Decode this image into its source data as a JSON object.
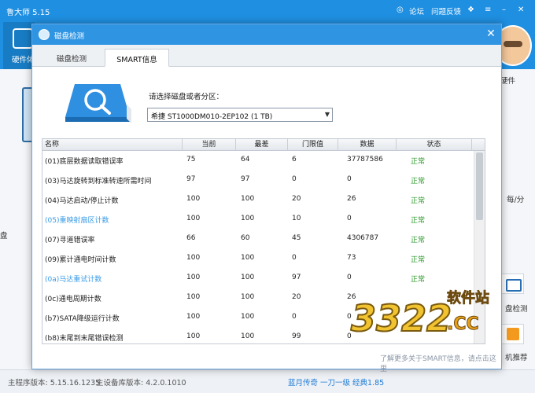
{
  "window": {
    "title": "鲁大师 5.15",
    "links": {
      "forum": "论坛",
      "feedback": "问题反馈"
    }
  },
  "toolbar": {
    "hardware_label": "硬件体"
  },
  "right_panel": {
    "hardware_label": "硬件",
    "rate_label": "每/分",
    "detect_label": "盘检测",
    "recommend_label": "机推荐"
  },
  "left_panel": {
    "fragment": "盘"
  },
  "status": {
    "program_version": "主程序版本: 5.15.16.1235",
    "library_version": "主设备库版本: 4.2.0.1010",
    "ad_link": "蓝月传奇 一刀一级 经典1.85"
  },
  "dialog": {
    "title": "磁盘检测",
    "tabs": {
      "disk_check": "磁盘检测",
      "smart": "SMART信息"
    },
    "select_prompt": "请选择磁盘或者分区：",
    "selected_disk": "希捷 ST1000DM010-2EP102  (1 TB)",
    "learn_more": "了解更多关于SMART信息，请点击这里"
  },
  "table": {
    "headers": {
      "name": "名称",
      "current": "当前",
      "worst": "最差",
      "threshold": "门限值",
      "data": "数据",
      "status": "状态"
    },
    "rows": [
      {
        "name": "(01)底层数据读取错误率",
        "current": "75",
        "worst": "64",
        "threshold": "6",
        "data": "37787586",
        "status": "正常"
      },
      {
        "name": "(03)马达旋转到标准转速所需时间",
        "current": "97",
        "worst": "97",
        "threshold": "0",
        "data": "0",
        "status": "正常"
      },
      {
        "name": "(04)马达启动/停止计数",
        "current": "100",
        "worst": "100",
        "threshold": "20",
        "data": "26",
        "status": "正常"
      },
      {
        "name": "(05)重映射扇区计数",
        "current": "100",
        "worst": "100",
        "threshold": "10",
        "data": "0",
        "status": "正常"
      },
      {
        "name": "(07)寻道错误率",
        "current": "66",
        "worst": "60",
        "threshold": "45",
        "data": "4306787",
        "status": "正常"
      },
      {
        "name": "(09)累计通电时间计数",
        "current": "100",
        "worst": "100",
        "threshold": "0",
        "data": "73",
        "status": "正常"
      },
      {
        "name": "(0a)马达重试计数",
        "current": "100",
        "worst": "100",
        "threshold": "97",
        "data": "0",
        "status": "正常"
      },
      {
        "name": "(0c)通电周期计数",
        "current": "100",
        "worst": "100",
        "threshold": "20",
        "data": "26",
        "status": ""
      },
      {
        "name": "(b7)SATA降级运行计数",
        "current": "100",
        "worst": "100",
        "threshold": "0",
        "data": "0",
        "status": ""
      },
      {
        "name": "(b8)末尾到末尾错误检测",
        "current": "100",
        "worst": "100",
        "threshold": "99",
        "data": "0",
        "status": ""
      }
    ]
  },
  "watermark": {
    "number": "3322",
    "domain": ".CC",
    "site_name": "软件站"
  },
  "colors": {
    "titlebar": "#1f8fe1",
    "dialog_titlebar": "#2f95e3",
    "status_ok": "#2c9a2c",
    "highlight_row": "#3a9be6",
    "link": "#1d7bd6"
  }
}
